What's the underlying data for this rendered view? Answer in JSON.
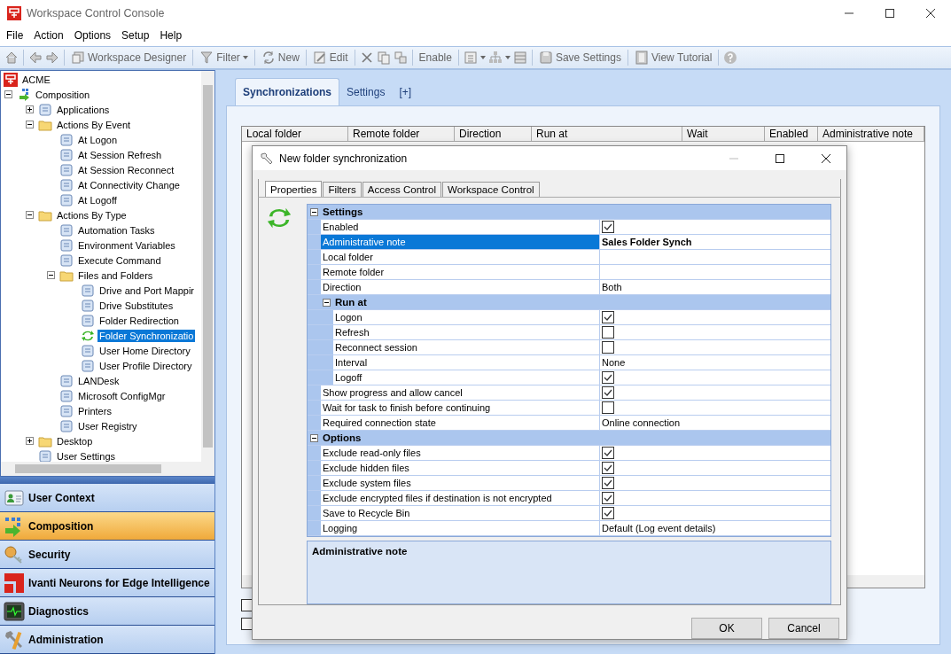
{
  "window": {
    "title": "Workspace Control Console"
  },
  "menu": [
    "File",
    "Action",
    "Options",
    "Setup",
    "Help"
  ],
  "toolbar": {
    "buttons": [
      {
        "label": "Workspace Designer",
        "dropdown": false
      },
      {
        "label": "Filter",
        "dropdown": true
      },
      {
        "label": "New",
        "dropdown": false
      },
      {
        "label": "Edit",
        "dropdown": false
      },
      {
        "label": "Enable",
        "dropdown": false
      },
      {
        "label": "Save Settings",
        "dropdown": false
      },
      {
        "label": "View Tutorial",
        "dropdown": false
      }
    ]
  },
  "tree": {
    "title": "ACME",
    "items": [
      {
        "label": "Composition",
        "kind": "composition",
        "selected": false,
        "expanded": true,
        "children": [
          {
            "label": "Applications",
            "kind": "item",
            "selected": false,
            "expanded": false
          },
          {
            "label": "Actions By Event",
            "kind": "folder",
            "selected": false,
            "expanded": true,
            "children": [
              {
                "label": "At Logon",
                "kind": "item",
                "selected": false
              },
              {
                "label": "At Session Refresh",
                "kind": "item",
                "selected": false
              },
              {
                "label": "At Session Reconnect",
                "kind": "item",
                "selected": false
              },
              {
                "label": "At Connectivity Change",
                "kind": "item",
                "selected": false
              },
              {
                "label": "At Logoff",
                "kind": "item",
                "selected": false
              }
            ]
          },
          {
            "label": "Actions By Type",
            "kind": "folder",
            "selected": false,
            "expanded": true,
            "children": [
              {
                "label": "Automation Tasks",
                "kind": "item",
                "selected": false
              },
              {
                "label": "Environment Variables",
                "kind": "item",
                "selected": false
              },
              {
                "label": "Execute Command",
                "kind": "item",
                "selected": false
              },
              {
                "label": "Files and Folders",
                "kind": "folder",
                "selected": false,
                "expanded": true,
                "children": [
                  {
                    "label": "Drive and Port Mappir",
                    "kind": "item",
                    "selected": false
                  },
                  {
                    "label": "Drive Substitutes",
                    "kind": "item",
                    "selected": false
                  },
                  {
                    "label": "Folder Redirection",
                    "kind": "item",
                    "selected": false
                  },
                  {
                    "label": "Folder Synchronizatio",
                    "kind": "sync",
                    "selected": true
                  },
                  {
                    "label": "User Home Directory",
                    "kind": "item",
                    "selected": false
                  },
                  {
                    "label": "User Profile Directory",
                    "kind": "item",
                    "selected": false
                  }
                ]
              },
              {
                "label": "LANDesk",
                "kind": "item",
                "selected": false
              },
              {
                "label": "Microsoft ConfigMgr",
                "kind": "item",
                "selected": false
              },
              {
                "label": "Printers",
                "kind": "item",
                "selected": false
              },
              {
                "label": "User Registry",
                "kind": "item",
                "selected": false
              }
            ]
          },
          {
            "label": "Desktop",
            "kind": "folder",
            "selected": false,
            "expanded": false
          },
          {
            "label": "User Settings",
            "kind": "item",
            "selected": false
          }
        ]
      }
    ]
  },
  "nav": [
    {
      "label": "User Context",
      "selected": false
    },
    {
      "label": "Composition",
      "selected": true
    },
    {
      "label": "Security",
      "selected": false
    },
    {
      "label": "Ivanti Neurons for Edge Intelligence",
      "selected": false
    },
    {
      "label": "Diagnostics",
      "selected": false
    },
    {
      "label": "Administration",
      "selected": false
    }
  ],
  "content": {
    "tabs": [
      {
        "label": "Synchronizations",
        "selected": true
      },
      {
        "label": "Settings",
        "selected": false
      },
      {
        "label": "[+]",
        "selected": false
      }
    ],
    "table": {
      "columns": [
        "Local folder",
        "Remote folder",
        "Direction",
        "Run at",
        "Wait",
        "Enabled",
        "Administrative note"
      ]
    },
    "checkboxes": [
      {
        "checked": false
      },
      {
        "checked": false
      }
    ]
  },
  "dialog": {
    "title": "New folder synchronization",
    "tabs": [
      {
        "label": "Properties",
        "selected": true
      },
      {
        "label": "Filters",
        "selected": false
      },
      {
        "label": "Access Control",
        "selected": false
      },
      {
        "label": "Workspace Control",
        "selected": false
      }
    ],
    "grid": [
      {
        "title": "Settings",
        "expanded": true,
        "items": [
          {
            "kind": "check",
            "label": "Enabled",
            "checked": true,
            "selected": false
          },
          {
            "kind": "text",
            "label": "Administrative note",
            "value": "Sales Folder Synch",
            "modified": true,
            "selected": true
          },
          {
            "kind": "text",
            "label": "Local folder",
            "selected": false
          },
          {
            "kind": "text",
            "label": "Remote folder",
            "selected": false
          },
          {
            "kind": "text",
            "label": "Direction",
            "value": "Both",
            "modified": false,
            "selected": false
          },
          {
            "kind": "group",
            "title": "Run at",
            "expanded": true,
            "items": [
              {
                "kind": "check",
                "label": "Logon",
                "checked": true,
                "selected": false
              },
              {
                "kind": "check",
                "label": "Refresh",
                "checked": false,
                "selected": false
              },
              {
                "kind": "check",
                "label": "Reconnect session",
                "checked": false,
                "selected": false
              },
              {
                "kind": "text",
                "label": "Interval",
                "value": "None",
                "modified": false,
                "selected": false
              },
              {
                "kind": "check",
                "label": "Logoff",
                "checked": true,
                "selected": false
              }
            ]
          },
          {
            "kind": "check",
            "label": "Show progress and allow cancel",
            "checked": true,
            "selected": false
          },
          {
            "kind": "check",
            "label": "Wait for task to finish before continuing",
            "checked": false,
            "selected": false
          },
          {
            "kind": "text",
            "label": "Required connection state",
            "value": "Online connection",
            "modified": false,
            "selected": false
          }
        ]
      },
      {
        "title": "Options",
        "expanded": true,
        "items": [
          {
            "kind": "check",
            "label": "Exclude read-only files",
            "checked": true,
            "selected": false
          },
          {
            "kind": "check",
            "label": "Exclude hidden files",
            "checked": true,
            "selected": false
          },
          {
            "kind": "check",
            "label": "Exclude system files",
            "checked": true,
            "selected": false
          },
          {
            "kind": "check",
            "label": "Exclude encrypted files if destination is not encrypted",
            "checked": true,
            "selected": false
          },
          {
            "kind": "check",
            "label": "Save to Recycle Bin",
            "checked": true,
            "selected": false
          },
          {
            "kind": "text",
            "label": "Logging",
            "value": "Default (Log event details)",
            "modified": false,
            "selected": false
          }
        ]
      }
    ],
    "description": {
      "title": "Administrative note"
    },
    "buttons": [
      "OK",
      "Cancel"
    ]
  }
}
